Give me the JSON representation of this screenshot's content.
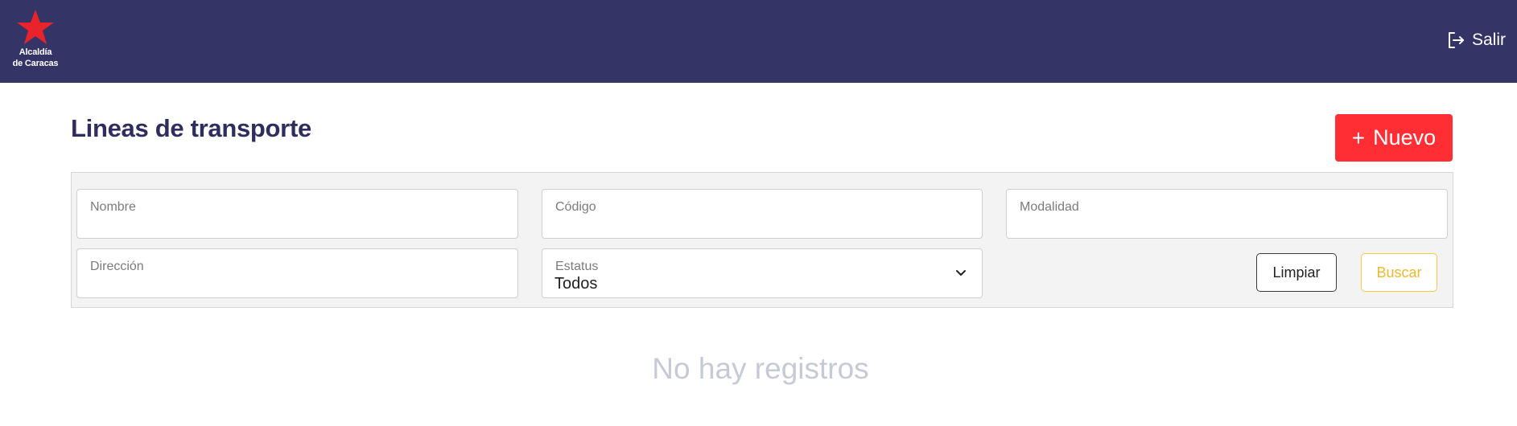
{
  "header": {
    "logo": {
      "line1": "Alcaldía",
      "line2": "de Caracas",
      "icon": "star-icon",
      "star_color": "#e8232b"
    },
    "logout_label": "Salir",
    "logout_icon": "logout-icon",
    "bg_color": "#343467"
  },
  "page": {
    "title": "Lineas de transporte",
    "new_button": {
      "plus": "+",
      "label": "Nuevo",
      "color": "#ff2d34"
    }
  },
  "filters": {
    "nombre": {
      "label": "Nombre",
      "value": ""
    },
    "codigo": {
      "label": "Código",
      "value": ""
    },
    "modalidad": {
      "label": "Modalidad",
      "value": ""
    },
    "direccion": {
      "label": "Dirección",
      "value": ""
    },
    "estatus": {
      "label": "Estatus",
      "value": "Todos",
      "icon": "chevron-down-icon"
    },
    "clear_label": "Limpiar",
    "search_label": "Buscar"
  },
  "results": {
    "empty_message": "No hay registros"
  }
}
